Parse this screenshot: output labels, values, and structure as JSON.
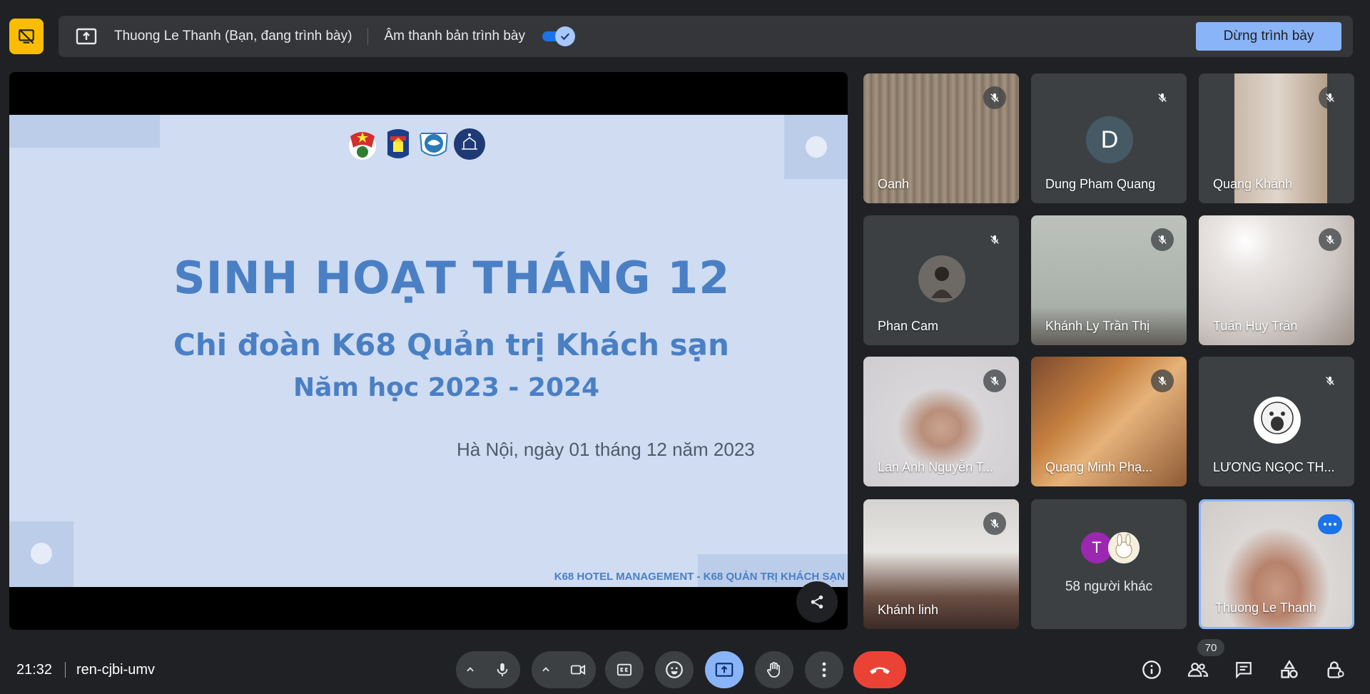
{
  "presenting_bar": {
    "presenter_text": "Thuong Le Thanh (Bạn, đang trình bày)",
    "audio_label": "Âm thanh bản trình bày",
    "audio_enabled": true,
    "stop_button": "Dừng trình bày"
  },
  "slide": {
    "title": "SINH HOẠT THÁNG 12",
    "subtitle": "Chi đoàn K68 Quản trị Khách sạn",
    "year": "Năm học 2023 - 2024",
    "date_line": "Hà Nội, ngày 01 tháng 12 năm 2023",
    "footer": "K68 HOTEL MANAGEMENT - K68 QUẢN TRỊ KHÁCH SẠN"
  },
  "participants": [
    {
      "name": "Oanh",
      "muted": true
    },
    {
      "name": "Dung Pham Quang",
      "muted": true,
      "avatar_letter": "D"
    },
    {
      "name": "Quang Khánh",
      "muted": true
    },
    {
      "name": "Phan Cam",
      "muted": true
    },
    {
      "name": "Khánh Ly Trần Thị",
      "muted": true
    },
    {
      "name": "Tuấn Huy Trần",
      "muted": true
    },
    {
      "name": "Lan Anh Nguyễn T...",
      "muted": true
    },
    {
      "name": "Quang Minh Phạ...",
      "muted": true
    },
    {
      "name": "LƯƠNG NGỌC TH...",
      "muted": true
    },
    {
      "name": "Khánh linh",
      "muted": true
    },
    {
      "name": "Thuong Le Thanh",
      "muted": false
    }
  ],
  "others_tile": {
    "label": "58 người khác",
    "avatar_letter": "T"
  },
  "bottom_bar": {
    "time": "21:32",
    "meeting_code": "ren-cjbi-umv",
    "participant_count": "70"
  },
  "colors": {
    "background": "#202124",
    "accent_blue": "#8ab4f8",
    "end_call_red": "#ea4335",
    "presenting_yellow": "#fbbc04"
  }
}
